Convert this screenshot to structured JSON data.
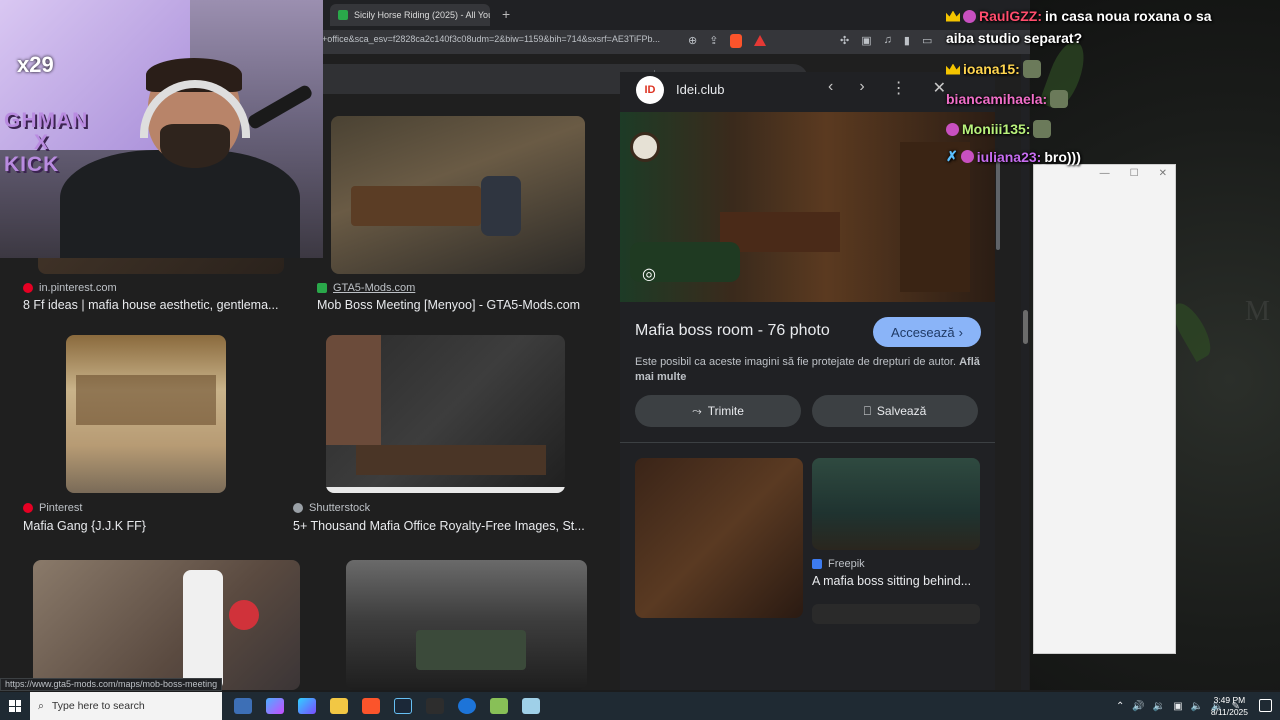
{
  "browser": {
    "tab_title": "Sicily Horse Riding (2025) - All You N",
    "new_tab": "+",
    "url": "+office&sca_esv=f2828ca2c140f3c08udm=2&biw=1159&bih=714&sxsrf=AE3TiFPb..."
  },
  "search": {
    "icons": [
      "close-icon",
      "keyboard-icon",
      "mic-icon",
      "lens-icon",
      "search-icon"
    ]
  },
  "results": [
    {
      "source": "in.pinterest.com",
      "title": "8 Ff ideas | mafia house aesthetic, gentlema...",
      "source_color": "#e60023"
    },
    {
      "source": "GTA5-Mods.com",
      "title": "Mob Boss Meeting [Menyoo] - GTA5-Mods.com",
      "source_color": "#2aa84a"
    },
    {
      "source": "Pinterest",
      "title": "Mafia Gang {J.J.K FF}",
      "source_color": "#e60023"
    },
    {
      "source": "Shutterstock",
      "title": "5+ Thousand Mafia Office Royalty-Free Images, St...",
      "source_color": "#9aa0a6"
    }
  ],
  "panel": {
    "site_name": "Idei.club",
    "title": "Mafia boss room - 76 photo",
    "visit_label": "Accesează",
    "copyright_text": "Este posibil ca aceste imagini să fie protejate de drepturi de autor.",
    "learn_more": "Află mai multe",
    "share_label": "Trimite",
    "save_label": "Salvează",
    "related": {
      "source": "Freepik",
      "title": "A mafia boss sitting behind..."
    }
  },
  "chat": [
    {
      "user": "RaulGZZ:",
      "message": "in casa noua roxana o sa",
      "user_color": "#ff4d6d"
    },
    {
      "user": "",
      "message": "aiba studio separat?",
      "user_color": "#ffffff"
    },
    {
      "user": "ioana15:",
      "message": "",
      "user_color": "#ffd54f"
    },
    {
      "user": "biancamihaela:",
      "message": "",
      "user_color": "#f06ec8"
    },
    {
      "user": "Moniii135:",
      "message": "",
      "user_color": "#b9f27c"
    },
    {
      "user": "iuliana23:",
      "message": "bro)))",
      "user_color": "#c66cf0"
    }
  ],
  "overlay": {
    "multiplier": "x29",
    "kick_text_1": "GHMAN",
    "kick_text_2": "X",
    "kick_text_3": "KICK"
  },
  "statusbar": {
    "hover_url": "https://www.gta5-mods.com/maps/mob-boss-meeting"
  },
  "taskbar": {
    "search_placeholder": "Type here to search",
    "time": "3:49 PM",
    "date": "8/11/2025"
  },
  "colors": {
    "accent_blue": "#8ab4f8",
    "page_bg": "#1f1f1f",
    "panel_bg": "#202124"
  }
}
